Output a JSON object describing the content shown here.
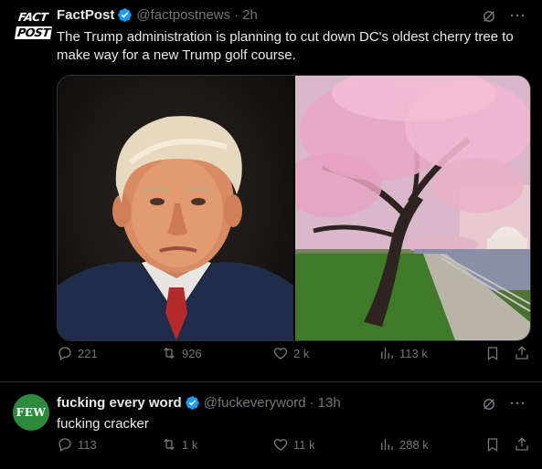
{
  "tweets": [
    {
      "avatar_label_top": "FACT",
      "avatar_label_bottom": "POST",
      "name": "FactPost",
      "handle": "@factpostnews",
      "dot": "·",
      "time": "2h",
      "text": "The Trump administration is planning to cut down DC's oldest cherry tree to make way for a new Trump golf course.",
      "media": [
        "portrait-photo",
        "cherry-blossom-photo"
      ],
      "more": "···",
      "stats": {
        "replies": "221",
        "reposts": "926",
        "likes": "2 k",
        "views": "113 k"
      }
    },
    {
      "avatar_label": "FEW",
      "name": "fucking every word",
      "handle": "@fuckeveryword",
      "dot": "·",
      "time": "13h",
      "text": "fucking cracker",
      "more": "···",
      "stats": {
        "replies": "113",
        "reposts": "1 k",
        "likes": "11 k",
        "views": "288 k"
      }
    }
  ],
  "colors": {
    "background": "#000000",
    "text": "#e7e9ea",
    "muted": "#71767b",
    "verified": "#1d9bf0",
    "divider": "#2f3336",
    "few_avatar": "#2e8b3e"
  },
  "icons": [
    "verified-badge-icon",
    "grok-icon",
    "more-icon",
    "reply-icon",
    "repost-icon",
    "like-icon",
    "views-icon",
    "bookmark-icon",
    "share-icon"
  ]
}
